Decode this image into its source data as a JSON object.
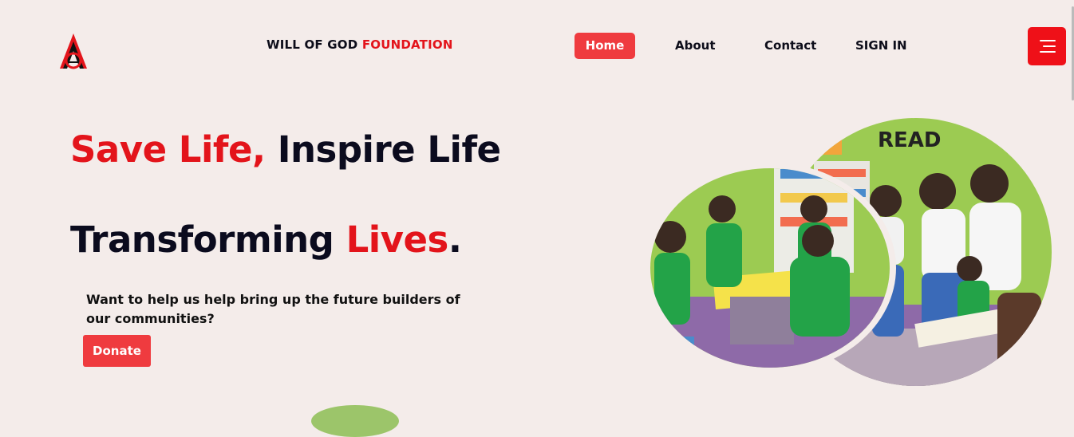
{
  "header": {
    "brand_prefix": "WILL OF GOD",
    "brand_accent": "FOUNDATION",
    "nav": [
      {
        "label": "Home",
        "active": true
      },
      {
        "label": "About",
        "active": false
      },
      {
        "label": "Contact",
        "active": false
      },
      {
        "label": "SIGN IN",
        "active": false
      }
    ],
    "menu_icon": "hamburger-icon"
  },
  "hero": {
    "title_red": "Save Life,",
    "title_dark": "Inspire Life",
    "sub_dark": "Transforming",
    "sub_red": "Lives",
    "sub_dot": ".",
    "text": "Want to help us help bring up the future builders of our communities?",
    "donate_label": "Donate",
    "photo_sign": "READ"
  },
  "colors": {
    "accent": "#e3141b",
    "button": "#ef3b3f",
    "background": "#f4ecea",
    "text_dark": "#0b0b1e"
  }
}
